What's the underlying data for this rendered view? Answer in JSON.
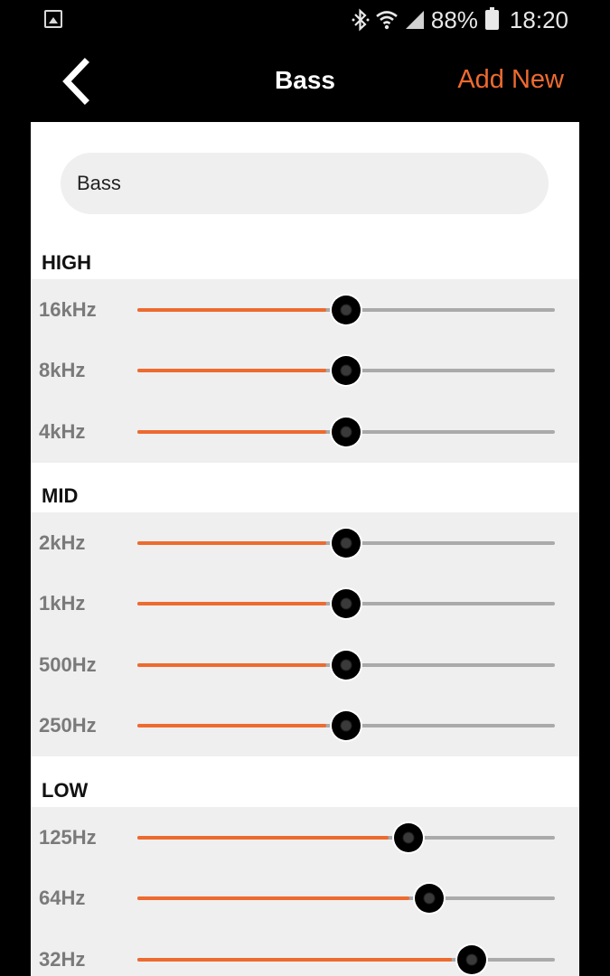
{
  "status_bar": {
    "battery": "88%",
    "time": "18:20",
    "icons": [
      "gallery-icon",
      "bluetooth-icon",
      "wifi-icon",
      "signal-icon",
      "battery-charging-icon"
    ]
  },
  "header": {
    "back_icon": "chevron-left-icon",
    "title": "Bass",
    "add_new_label": "Add New",
    "accent_color": "#ee6a2f"
  },
  "preset": {
    "name_value": "Bass"
  },
  "sections": [
    {
      "title": "HIGH",
      "bands": [
        {
          "label": "16kHz",
          "level": 0.5
        },
        {
          "label": "8kHz",
          "level": 0.5
        },
        {
          "label": "4kHz",
          "level": 0.5
        }
      ]
    },
    {
      "title": "MID",
      "bands": [
        {
          "label": "2kHz",
          "level": 0.5
        },
        {
          "label": "1kHz",
          "level": 0.5
        },
        {
          "label": "500Hz",
          "level": 0.5
        },
        {
          "label": "250Hz",
          "level": 0.5
        }
      ]
    },
    {
      "title": "LOW",
      "bands": [
        {
          "label": "125Hz",
          "level": 0.65
        },
        {
          "label": "64Hz",
          "level": 0.7
        },
        {
          "label": "32Hz",
          "level": 0.8
        }
      ]
    }
  ]
}
